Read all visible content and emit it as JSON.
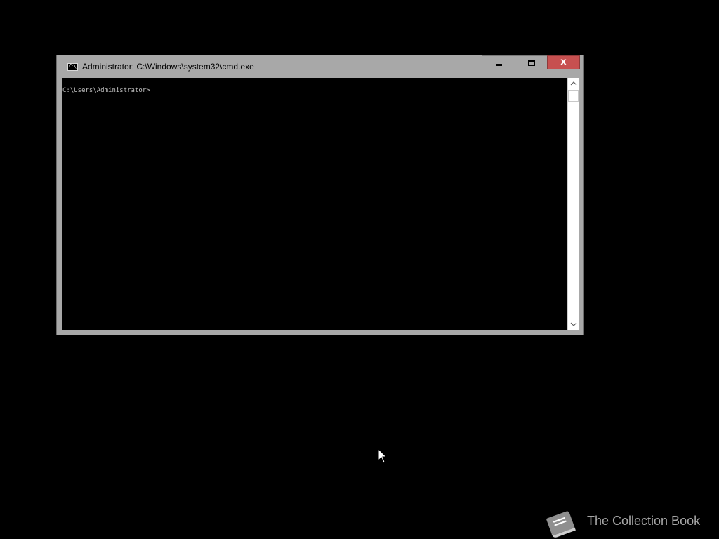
{
  "window": {
    "title": "Administrator: C:\\Windows\\system32\\cmd.exe",
    "app_icon_text": "C:\\_",
    "controls": {
      "minimize_icon": "minimize-icon",
      "maximize_icon": "maximize-icon",
      "close_glyph": "x",
      "close_color": "#c75050"
    }
  },
  "console": {
    "lines": [
      "C:\\Users\\Administrator>"
    ],
    "background": "#000000",
    "text_color": "#c0c0c0"
  },
  "scrollbar": {
    "up_glyph": "⌃",
    "down_glyph": "⌄"
  },
  "watermark": {
    "icon": "book-icon",
    "text": "The Collection Book"
  }
}
